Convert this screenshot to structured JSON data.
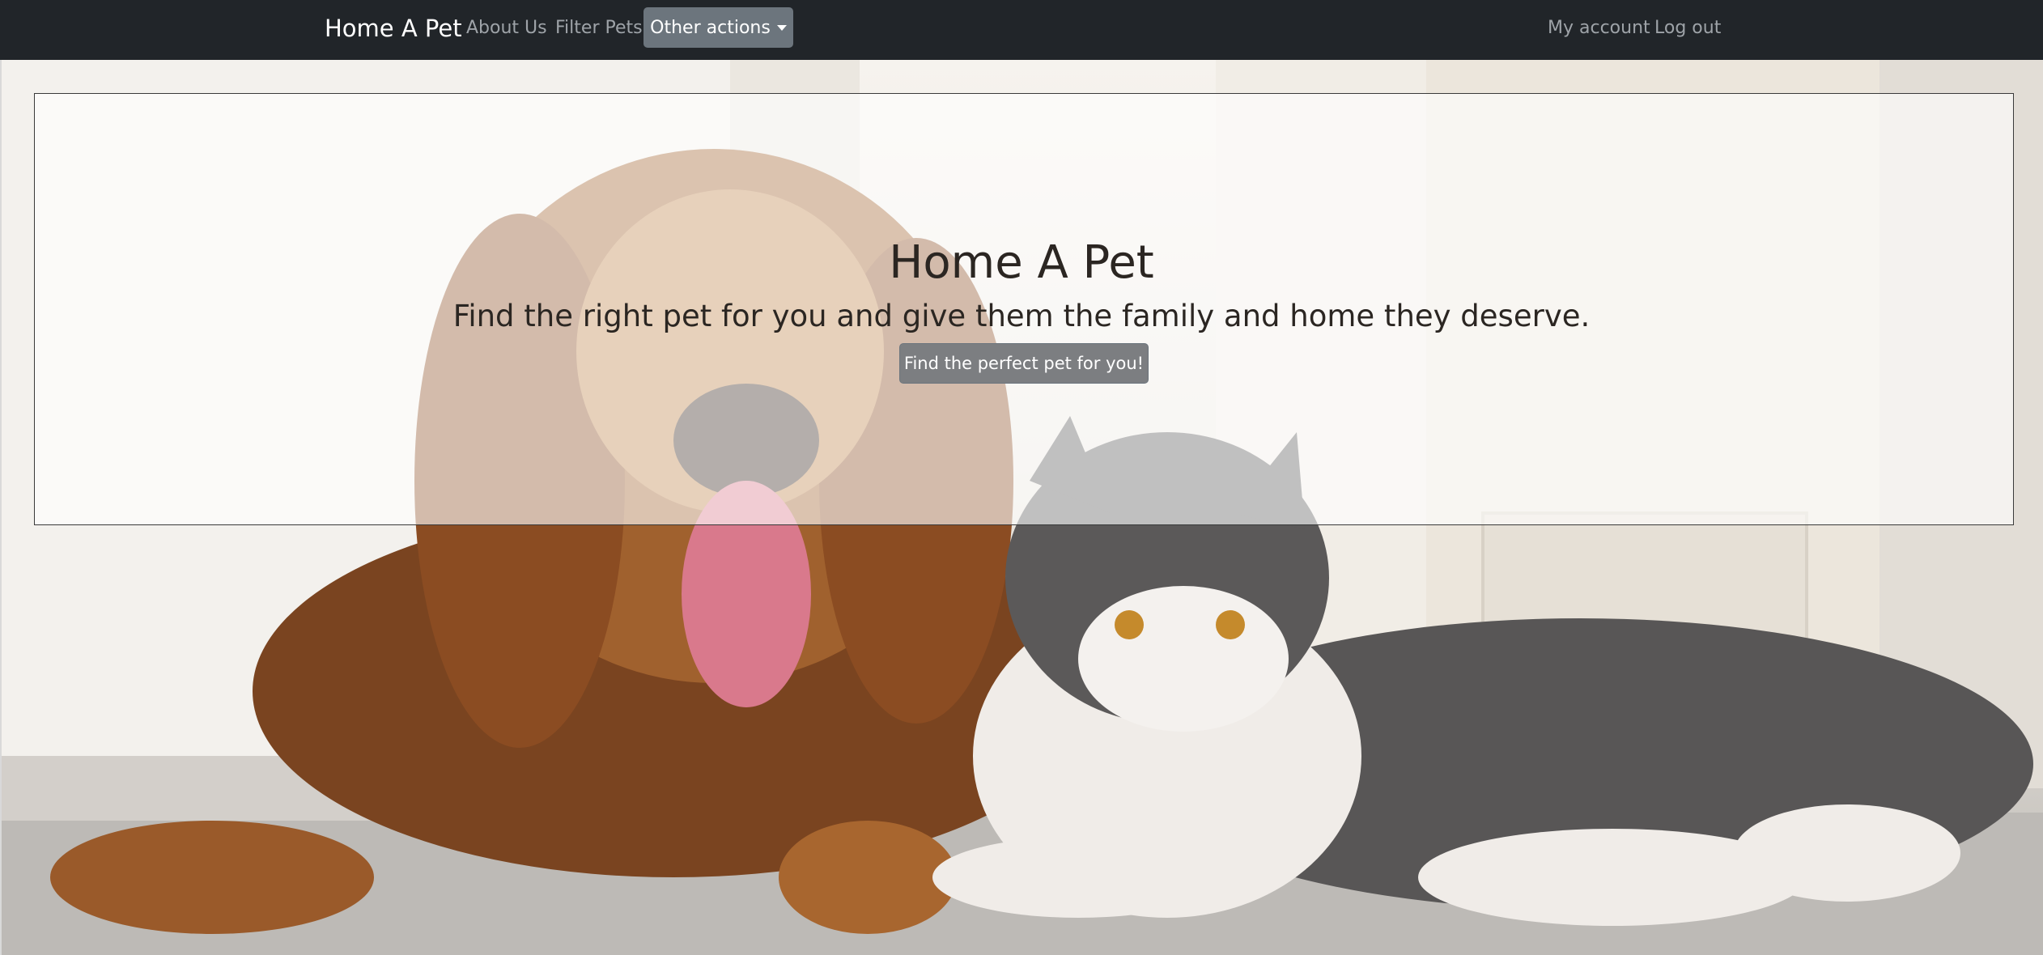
{
  "navbar": {
    "brand": "Home A Pet",
    "links": {
      "about": "About Us",
      "filter": "Filter Pets",
      "other_actions": "Other actions",
      "my_account": "My account",
      "logout": "Log out"
    }
  },
  "hero": {
    "title": "Home A Pet",
    "subtitle": "Find the right pet for you and give them the family and home they deserve.",
    "cta_label": "Find the perfect pet for you!"
  },
  "colors": {
    "navbar_bg": "#212529",
    "button_bg": "#6c757d",
    "text_dark": "#2b2622"
  }
}
